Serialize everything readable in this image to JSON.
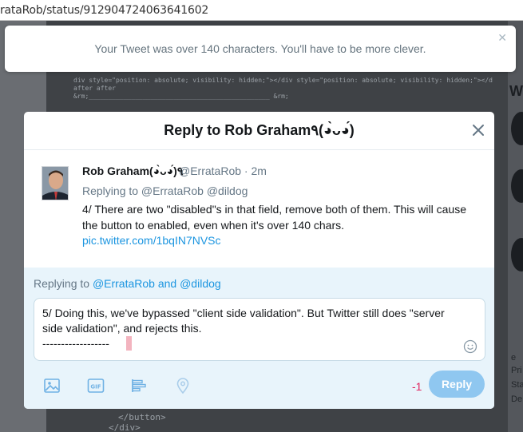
{
  "browser": {
    "url": "rataRob/status/912904724063641602"
  },
  "background": {
    "code_lines": [
      "div style=\"position: absolute; visibility: hidden;\"></div style=\"position: absolute; visibility: hidden;\"></d",
      "after                                             after",
      "&rm;_______________________________________________ &rm;",
      "</button>",
      "</div>"
    ],
    "rail_letter": "W",
    "rail_texts": [
      "e",
      "Pri",
      "Sta",
      "De"
    ]
  },
  "toast": {
    "message": "Your Tweet was over 140 characters. You'll have to be more clever."
  },
  "modal": {
    "title": "Reply to Rob Graham٩(◕̀ᴗ◕́)",
    "tweet": {
      "author_name": "Rob Graham(◕̀ᴗ◕́)٩",
      "handle_time": "@ErrataRob · 2m",
      "replying_to": "Replying to @ErrataRob @dildog",
      "text": "4/ There are two \"disabled\"s in that field, remove both of them. This will cause the button to enabled, even when it's over 140 chars.",
      "link": "pic.twitter.com/1bqIN7NVSc"
    },
    "composer": {
      "replying_prefix": "Replying to ",
      "replying_mentions": "@ErrataRob and @dildog",
      "text": "5/ Doing this, we've bypassed \"client side validation\". But Twitter still does \"server side validation\", and rejects this.\n------------------",
      "counter": "-1",
      "reply_label": "Reply"
    }
  },
  "colors": {
    "accent": "#1b95e0",
    "reply_button_disabled": "#8fc7f0",
    "error": "#e0245e",
    "composer_bg": "#e8f4fb"
  }
}
